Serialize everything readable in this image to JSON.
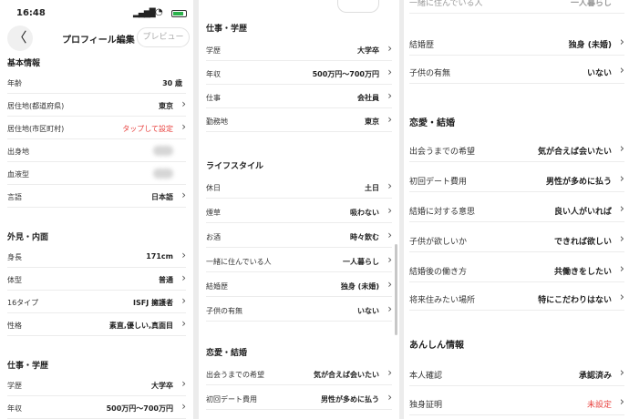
{
  "status": {
    "time": "16:48"
  },
  "header": {
    "title": "プロフィール編集",
    "preview_label": "プレビュー",
    "back_glyph": "〈"
  },
  "panel1": {
    "sections": {
      "basic": "基本情報",
      "appearance": "外見・内面",
      "work": "仕事・学歴"
    },
    "basic_rows": [
      {
        "label": "年齢",
        "value": "30 歳"
      },
      {
        "label": "居住地(都道府県)",
        "value": "東京"
      },
      {
        "label": "居住地(市区町村)",
        "value": "タップして設定"
      },
      {
        "label": "出身地",
        "value": ""
      },
      {
        "label": "血液型",
        "value": ""
      },
      {
        "label": "言語",
        "value": "日本語"
      }
    ],
    "appearance_rows": [
      {
        "label": "身長",
        "value": "171cm"
      },
      {
        "label": "体型",
        "value": "普通"
      },
      {
        "label": "16タイプ",
        "value": "ISFJ 擁護者"
      },
      {
        "label": "性格",
        "value": "素直,優しい,真面目"
      }
    ],
    "work_rows": [
      {
        "label": "学歴",
        "value": "大学卒"
      },
      {
        "label": "年収",
        "value": "500万円〜700万円"
      }
    ]
  },
  "panel2": {
    "sections": {
      "work": "仕事・学歴",
      "lifestyle": "ライフスタイル",
      "love": "恋愛・結婚"
    },
    "work_rows": [
      {
        "label": "学歴",
        "value": "大学卒"
      },
      {
        "label": "年収",
        "value": "500万円〜700万円"
      },
      {
        "label": "仕事",
        "value": "会社員"
      },
      {
        "label": "勤務地",
        "value": "東京"
      }
    ],
    "lifestyle_rows": [
      {
        "label": "休日",
        "value": "土日"
      },
      {
        "label": "煙草",
        "value": "吸わない"
      },
      {
        "label": "お酒",
        "value": "時々飲む"
      },
      {
        "label": "一緒に住んでいる人",
        "value": "一人暮らし"
      },
      {
        "label": "結婚歴",
        "value": "独身 (未婚)"
      },
      {
        "label": "子供の有無",
        "value": "いない"
      }
    ],
    "love_rows": [
      {
        "label": "出会うまでの希望",
        "value": "気が合えば会いたい"
      },
      {
        "label": "初回デート費用",
        "value": "男性が多めに払う"
      }
    ]
  },
  "panel3": {
    "top_partial": {
      "label": "一緒に住んでいる人",
      "value": "一人暮らし"
    },
    "top_rows": [
      {
        "label": "結婚歴",
        "value": "独身 (未婚)"
      },
      {
        "label": "子供の有無",
        "value": "いない"
      }
    ],
    "sections": {
      "love": "恋愛・結婚",
      "safety": "あんしん情報"
    },
    "love_rows": [
      {
        "label": "出会うまでの希望",
        "value": "気が合えば会いたい"
      },
      {
        "label": "初回デート費用",
        "value": "男性が多めに払う"
      },
      {
        "label": "結婚に対する意思",
        "value": "良い人がいれば"
      },
      {
        "label": "子供が欲しいか",
        "value": "できれば欲しい"
      },
      {
        "label": "結婚後の働き方",
        "value": "共働きをしたい"
      },
      {
        "label": "将来住みたい場所",
        "value": "特にこだわりはない"
      }
    ],
    "safety_rows": [
      {
        "label": "本人確認",
        "value": "承認済み"
      },
      {
        "label": "独身証明",
        "value": "未設定"
      }
    ]
  },
  "colors": {
    "accent_red": "#e8413e",
    "divider": "#ececec"
  },
  "icons": {
    "chevron": "chevron-right-icon"
  }
}
